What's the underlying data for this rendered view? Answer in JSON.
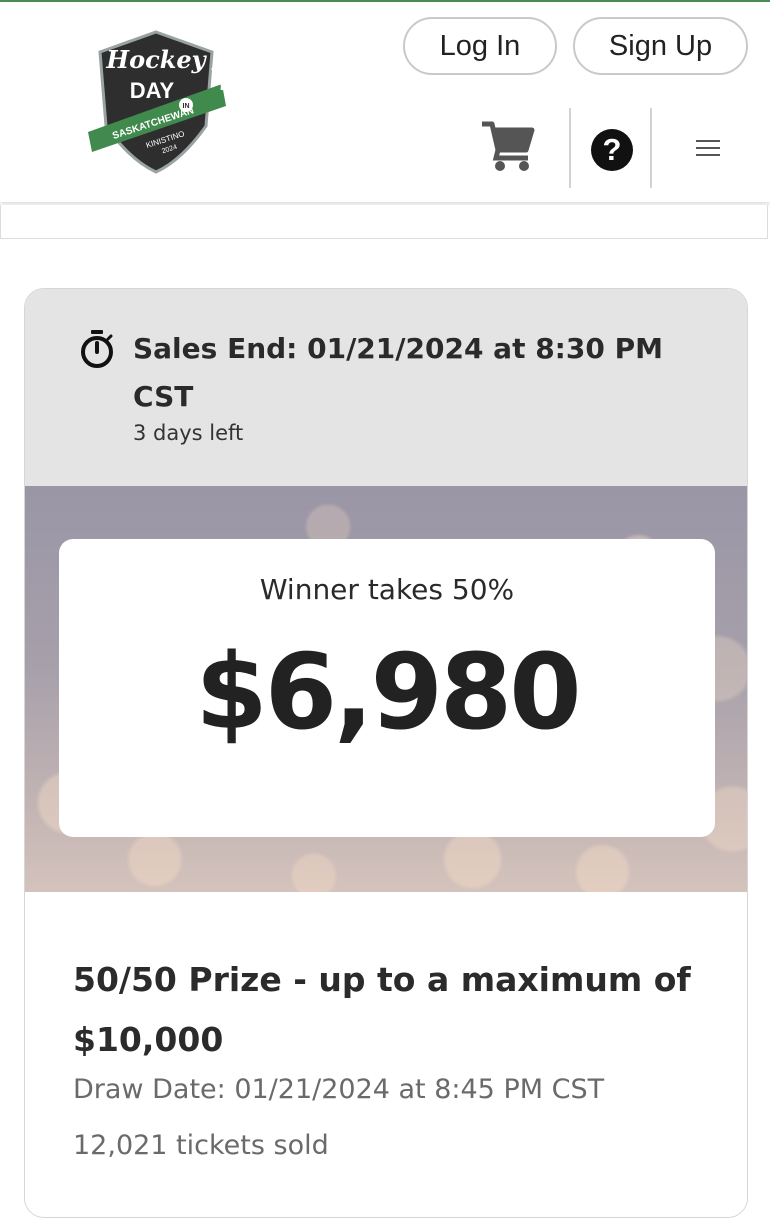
{
  "header": {
    "logo": {
      "script_text": "Hockey",
      "day_text": "DAY",
      "in_text": "IN",
      "province_text": "SASKATCHEWAN",
      "town_text": "KINISTINO",
      "year_text": "2024",
      "colors": {
        "dark": "#2e2e2e",
        "green": "#3f8a4c",
        "white": "#ffffff"
      }
    },
    "login_label": "Log In",
    "signup_label": "Sign Up",
    "cart_icon": "cart-icon",
    "help_icon_text": "?",
    "menu_icon": "hamburger-menu-icon"
  },
  "sales": {
    "icon": "stopwatch-icon",
    "title": "Sales End: 01/21/2024 at 8:30 PM CST",
    "days_left": "3 days left"
  },
  "prize": {
    "winner_text": "Winner takes 50%",
    "amount": "$6,980"
  },
  "details": {
    "title": "50/50 Prize - up to a maximum of $10,000",
    "draw_date": "Draw Date: 01/21/2024 at 8:45 PM CST",
    "tickets_sold": "12,021 tickets sold"
  },
  "colors": {
    "accent_green": "#4c8a58",
    "sales_bg": "#e4e4e4",
    "text_dark": "#222222",
    "text_muted": "#6a6a6a"
  }
}
